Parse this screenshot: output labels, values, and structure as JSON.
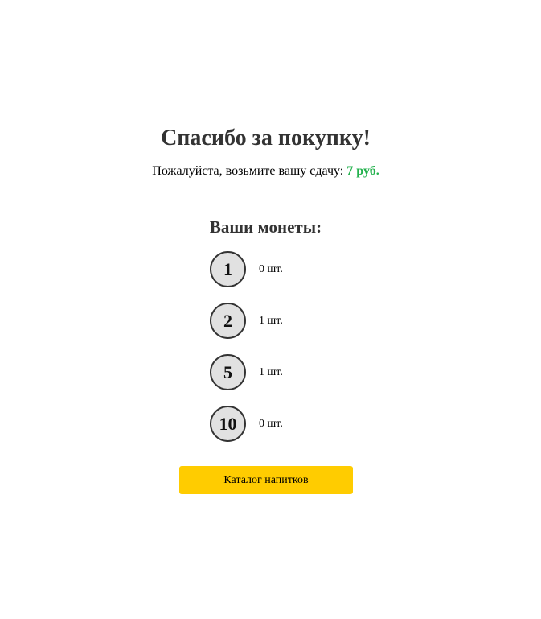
{
  "header": {
    "title": "Спасибо за покупку!"
  },
  "change": {
    "text": "Пожалуйста, возьмите вашу сдачу: ",
    "amount": "7 руб."
  },
  "coins": {
    "title": "Ваши монеты:",
    "items": [
      {
        "value": "1",
        "count": "0 шт."
      },
      {
        "value": "2",
        "count": "1 шт."
      },
      {
        "value": "5",
        "count": "1 шт."
      },
      {
        "value": "10",
        "count": "0 шт."
      }
    ]
  },
  "actions": {
    "catalog_label": "Каталог напитков"
  },
  "colors": {
    "accent_button": "#ffcc00",
    "change_amount": "#22b14c",
    "coin_fill": "#e1e1e1"
  }
}
